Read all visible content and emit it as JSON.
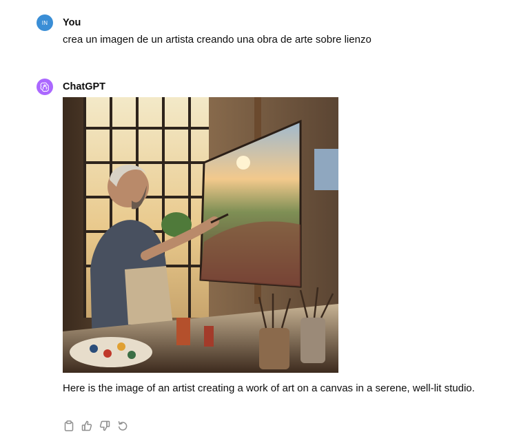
{
  "user_message": {
    "avatar_initials": "IN",
    "author": "You",
    "text": "crea un imagen de un artista creando una obra de arte sobre lienzo"
  },
  "assistant_message": {
    "author": "ChatGPT",
    "image_description_icon": "generated-image",
    "text": "Here is the image of an artist creating a work of art on a canvas in a serene, well-lit studio."
  },
  "actions": [
    {
      "name": "copy",
      "icon": "clipboard-icon"
    },
    {
      "name": "thumbs-up",
      "icon": "thumbs-up-icon"
    },
    {
      "name": "thumbs-down",
      "icon": "thumbs-down-icon"
    },
    {
      "name": "regenerate",
      "icon": "regenerate-icon"
    }
  ],
  "colors": {
    "user_avatar": "#3a8ed6",
    "bot_avatar": "#ab68ff",
    "icon_gray": "#8e8e8e"
  }
}
